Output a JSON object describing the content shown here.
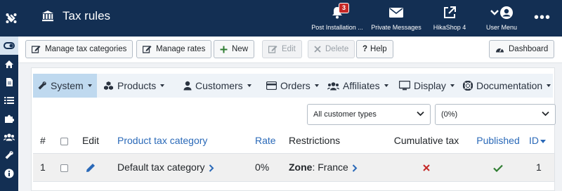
{
  "header": {
    "title": "Tax rules",
    "items": [
      {
        "label": "Post Installation ...",
        "badge": "3"
      },
      {
        "label": "Private Messages"
      },
      {
        "label": "HikaShop 4"
      },
      {
        "label": "User Menu"
      }
    ]
  },
  "toolbar": {
    "manage_tax_categories": "Manage tax categories",
    "manage_rates": "Manage rates",
    "new": "New",
    "edit": "Edit",
    "delete": "Delete",
    "help": "Help",
    "dashboard": "Dashboard"
  },
  "menu": [
    {
      "label": "System"
    },
    {
      "label": "Products"
    },
    {
      "label": "Customers"
    },
    {
      "label": "Orders"
    },
    {
      "label": "Affiliates"
    },
    {
      "label": "Display"
    },
    {
      "label": "Documentation"
    }
  ],
  "filters": {
    "customer_type": "All customer types",
    "rate": "(0%)"
  },
  "table": {
    "headers": {
      "num": "#",
      "edit": "Edit",
      "category": "Product tax category",
      "rate": "Rate",
      "restrictions": "Restrictions",
      "cumulative": "Cumulative tax",
      "published": "Published",
      "id": "ID"
    },
    "rows": [
      {
        "num": "1",
        "category": "Default tax category",
        "rate": "0%",
        "zone_label": "Zone",
        "zone_value": ": France",
        "id": "1"
      }
    ]
  },
  "colors": {
    "header_bg": "#132f53",
    "link": "#2a69b8",
    "cross": "#c52827",
    "check": "#2f7d32"
  }
}
